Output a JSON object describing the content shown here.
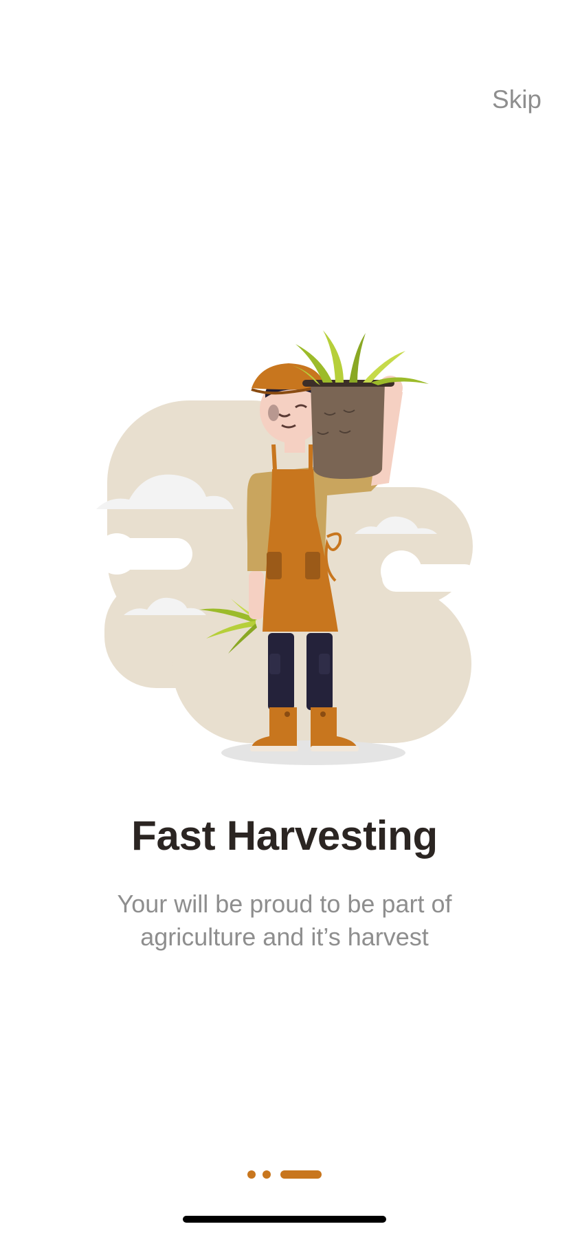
{
  "header": {
    "skip_label": "Skip"
  },
  "onboarding": {
    "title": "Fast Harvesting",
    "description_line1": "Your will be proud to be part of",
    "description_line2": "agriculture and it’s harvest"
  },
  "pager": {
    "total_pages": 3,
    "current_page": 3
  },
  "colors": {
    "accent": "#c8761e",
    "title_text": "#2b2522",
    "secondary_text": "#8e8e8e",
    "background": "#ffffff",
    "blob": "#e8dfcf"
  },
  "icons": {
    "illustration": "farmer-harvesting-illustration"
  }
}
